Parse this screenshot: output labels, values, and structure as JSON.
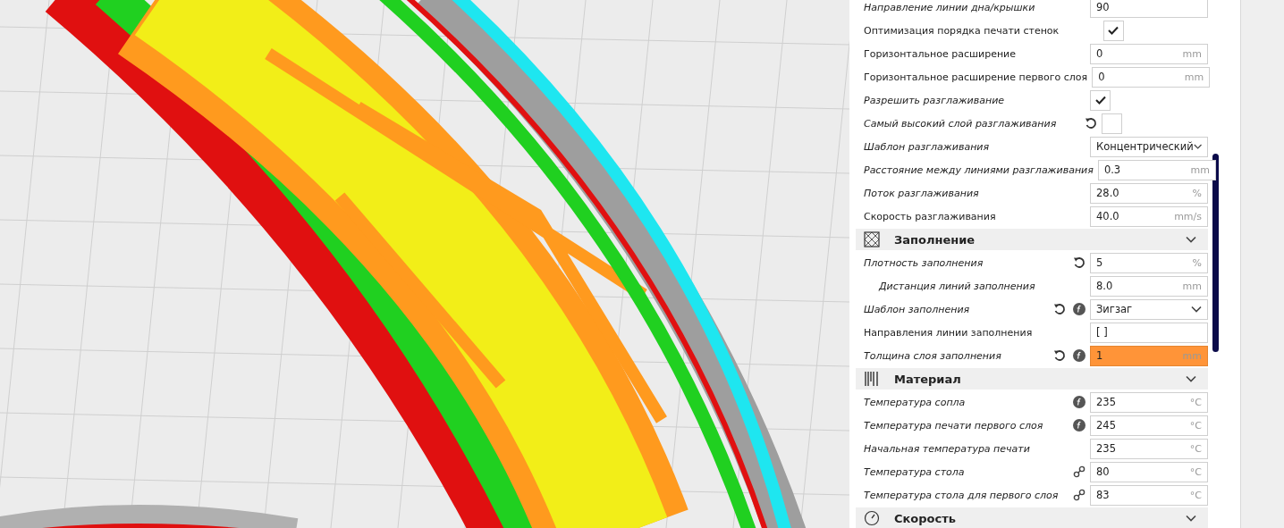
{
  "settings_panel": {
    "rows": [
      {
        "label": "Направление линии дна/крышки",
        "kind": "field",
        "changed": true,
        "value": "90"
      },
      {
        "label": "Оптимизация порядка печати стенок",
        "kind": "checkbox",
        "changed": false,
        "checked": true
      },
      {
        "label": "Горизонтальное расширение",
        "kind": "field",
        "changed": false,
        "value": "0",
        "unit": "mm"
      },
      {
        "label": "Горизонтальное расширение первого слоя",
        "kind": "field",
        "changed": false,
        "value": "0",
        "unit": "mm"
      },
      {
        "label": "Разрешить разглаживание",
        "kind": "checkbox",
        "changed": true,
        "checked": true
      },
      {
        "label": "Самый высокий слой разглаживания",
        "kind": "checkbox",
        "changed": true,
        "icons": [
          {
            "kind": "reset"
          }
        ],
        "checked": false
      },
      {
        "label": "Шаблон разглаживания",
        "kind": "dropdown",
        "changed": true,
        "value": "Концентрический"
      },
      {
        "label": "Расстояние между линиями разглаживания",
        "kind": "field",
        "changed": true,
        "value": "0.3",
        "unit": "mm"
      },
      {
        "label": "Поток разглаживания",
        "kind": "field",
        "changed": true,
        "value": "28.0",
        "unit": "%"
      },
      {
        "label": "Скорость разглаживания",
        "kind": "field",
        "changed": false,
        "value": "40.0",
        "unit": "mm/s"
      }
    ],
    "sections": [
      {
        "title": "Заполнение",
        "kind": "infill",
        "rows": [
          {
            "label": "Плотность заполнения",
            "kind": "field",
            "changed": true,
            "icons": [
              {
                "kind": "reset"
              }
            ],
            "value": "5",
            "unit": "%",
            "children": [
              {
                "label": "Дистанция линий заполнения",
                "kind": "field",
                "changed": true,
                "value": "8.0",
                "unit": "mm"
              }
            ]
          },
          {
            "label": "Шаблон заполнения",
            "kind": "dropdown",
            "changed": true,
            "icons": [
              {
                "kind": "reset"
              },
              {
                "kind": "formula"
              }
            ],
            "value": "Зигзаг"
          },
          {
            "label": "Направления линии заполнения",
            "kind": "field",
            "changed": false,
            "value": "[ ]"
          },
          {
            "label": "Толщина слоя заполнения",
            "kind": "field",
            "changed": true,
            "icons": [
              {
                "kind": "reset"
              },
              {
                "kind": "formula"
              }
            ],
            "value": "1",
            "unit": "mm",
            "warning": true
          }
        ]
      },
      {
        "title": "Материал",
        "kind": "material",
        "rows": [
          {
            "label": "Температура сопла",
            "kind": "field",
            "changed": true,
            "icons": [
              {
                "kind": "formula"
              }
            ],
            "value": "235",
            "unit": "°C"
          },
          {
            "label": "Температура печати первого слоя",
            "kind": "field",
            "changed": true,
            "icons": [
              {
                "kind": "formula"
              }
            ],
            "value": "245",
            "unit": "°C"
          },
          {
            "label": "Начальная температура печати",
            "kind": "field",
            "changed": true,
            "value": "235",
            "unit": "°C"
          },
          {
            "label": "Температура стола",
            "kind": "field",
            "changed": true,
            "icons": [
              {
                "kind": "link"
              }
            ],
            "value": "80",
            "unit": "°C"
          },
          {
            "label": "Температура стола для первого слоя",
            "kind": "field",
            "changed": true,
            "icons": [
              {
                "kind": "link"
              }
            ],
            "value": "83",
            "unit": "°C"
          }
        ]
      },
      {
        "title": "Скорость",
        "kind": "speed"
      }
    ]
  }
}
